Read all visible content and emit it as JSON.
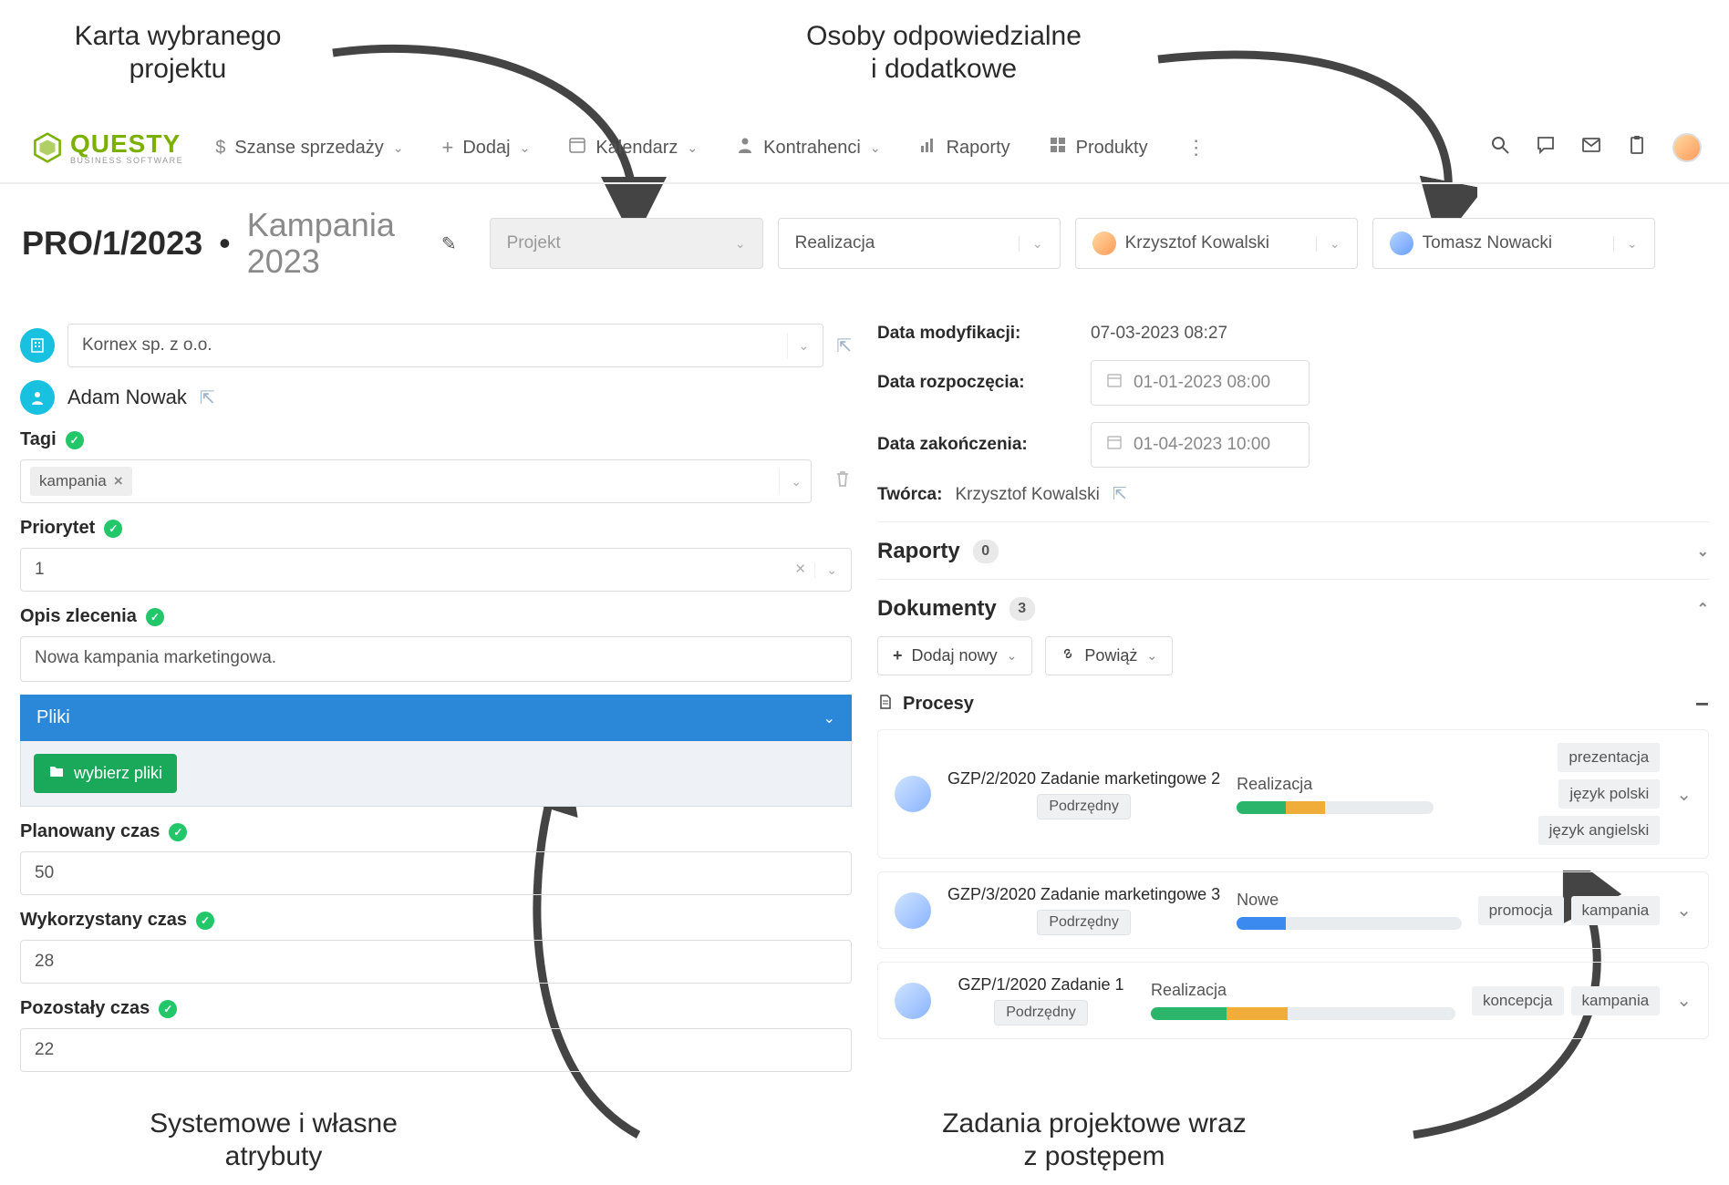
{
  "annotations": {
    "tl": "Karta wybranego\nprojektu",
    "tr": "Osoby odpowiedzialne\ni dodatkowe",
    "bl": "Systemowe i własne\natrybuty",
    "br": "Zadania projektowe wraz\nz postępem"
  },
  "nav": {
    "sales": "Szanse sprzedaży",
    "add": "Dodaj",
    "calendar": "Kalendarz",
    "contractors": "Kontrahenci",
    "reports": "Raporty",
    "products": "Produkty"
  },
  "logo": {
    "name": "QUESTY",
    "sub": "BUSINESS SOFTWARE"
  },
  "header": {
    "code": "PRO/1/2023",
    "campaign": "Kampania\n2023",
    "project": "Projekt",
    "status": "Realizacja",
    "owner": "Krzysztof Kowalski",
    "extra": "Tomasz Nowacki"
  },
  "left": {
    "company": "Kornex sp. z o.o.",
    "person": "Adam Nowak",
    "tags_label": "Tagi",
    "tag": "kampania",
    "priority_label": "Priorytet",
    "priority": "1",
    "desc_label": "Opis zlecenia",
    "desc": "Nowa kampania marketingowa.",
    "files_label": "Pliki",
    "choose_files": "wybierz pliki",
    "planned_label": "Planowany czas",
    "planned": "50",
    "used_label": "Wykorzystany czas",
    "used": "28",
    "remain_label": "Pozostały czas",
    "remain": "22"
  },
  "right": {
    "mod_label": "Data modyfikacji:",
    "mod": "07-03-2023 08:27",
    "start_label": "Data rozpoczęcia:",
    "start": "01-01-2023 08:00",
    "end_label": "Data zakończenia:",
    "end": "01-04-2023 10:00",
    "creator_label": "Twórca:",
    "creator": "Krzysztof Kowalski",
    "reports_label": "Raporty",
    "reports_count": "0",
    "docs_label": "Dokumenty",
    "docs_count": "3",
    "add_new": "Dodaj nowy",
    "link": "Powiąż",
    "processes": "Procesy"
  },
  "processes": [
    {
      "name": "GZP/2/2020 Zadanie marketingowe 2",
      "sub": "Podrzędny",
      "status": "Realizacja",
      "green": 25,
      "yellow": 20,
      "tags": [
        "prezentacja",
        "język polski",
        "język angielski"
      ]
    },
    {
      "name": "GZP/3/2020 Zadanie marketingowe 3",
      "sub": "Podrzędny",
      "status": "Nowe",
      "green": 0,
      "yellow": 0,
      "blue": 22,
      "tags": [
        "promocja",
        "kampania"
      ]
    },
    {
      "name": "GZP/1/2020 Zadanie 1",
      "sub": "Podrzędny",
      "status": "Realizacja",
      "green": 25,
      "yellow": 20,
      "tags": [
        "koncepcja",
        "kampania"
      ]
    }
  ]
}
